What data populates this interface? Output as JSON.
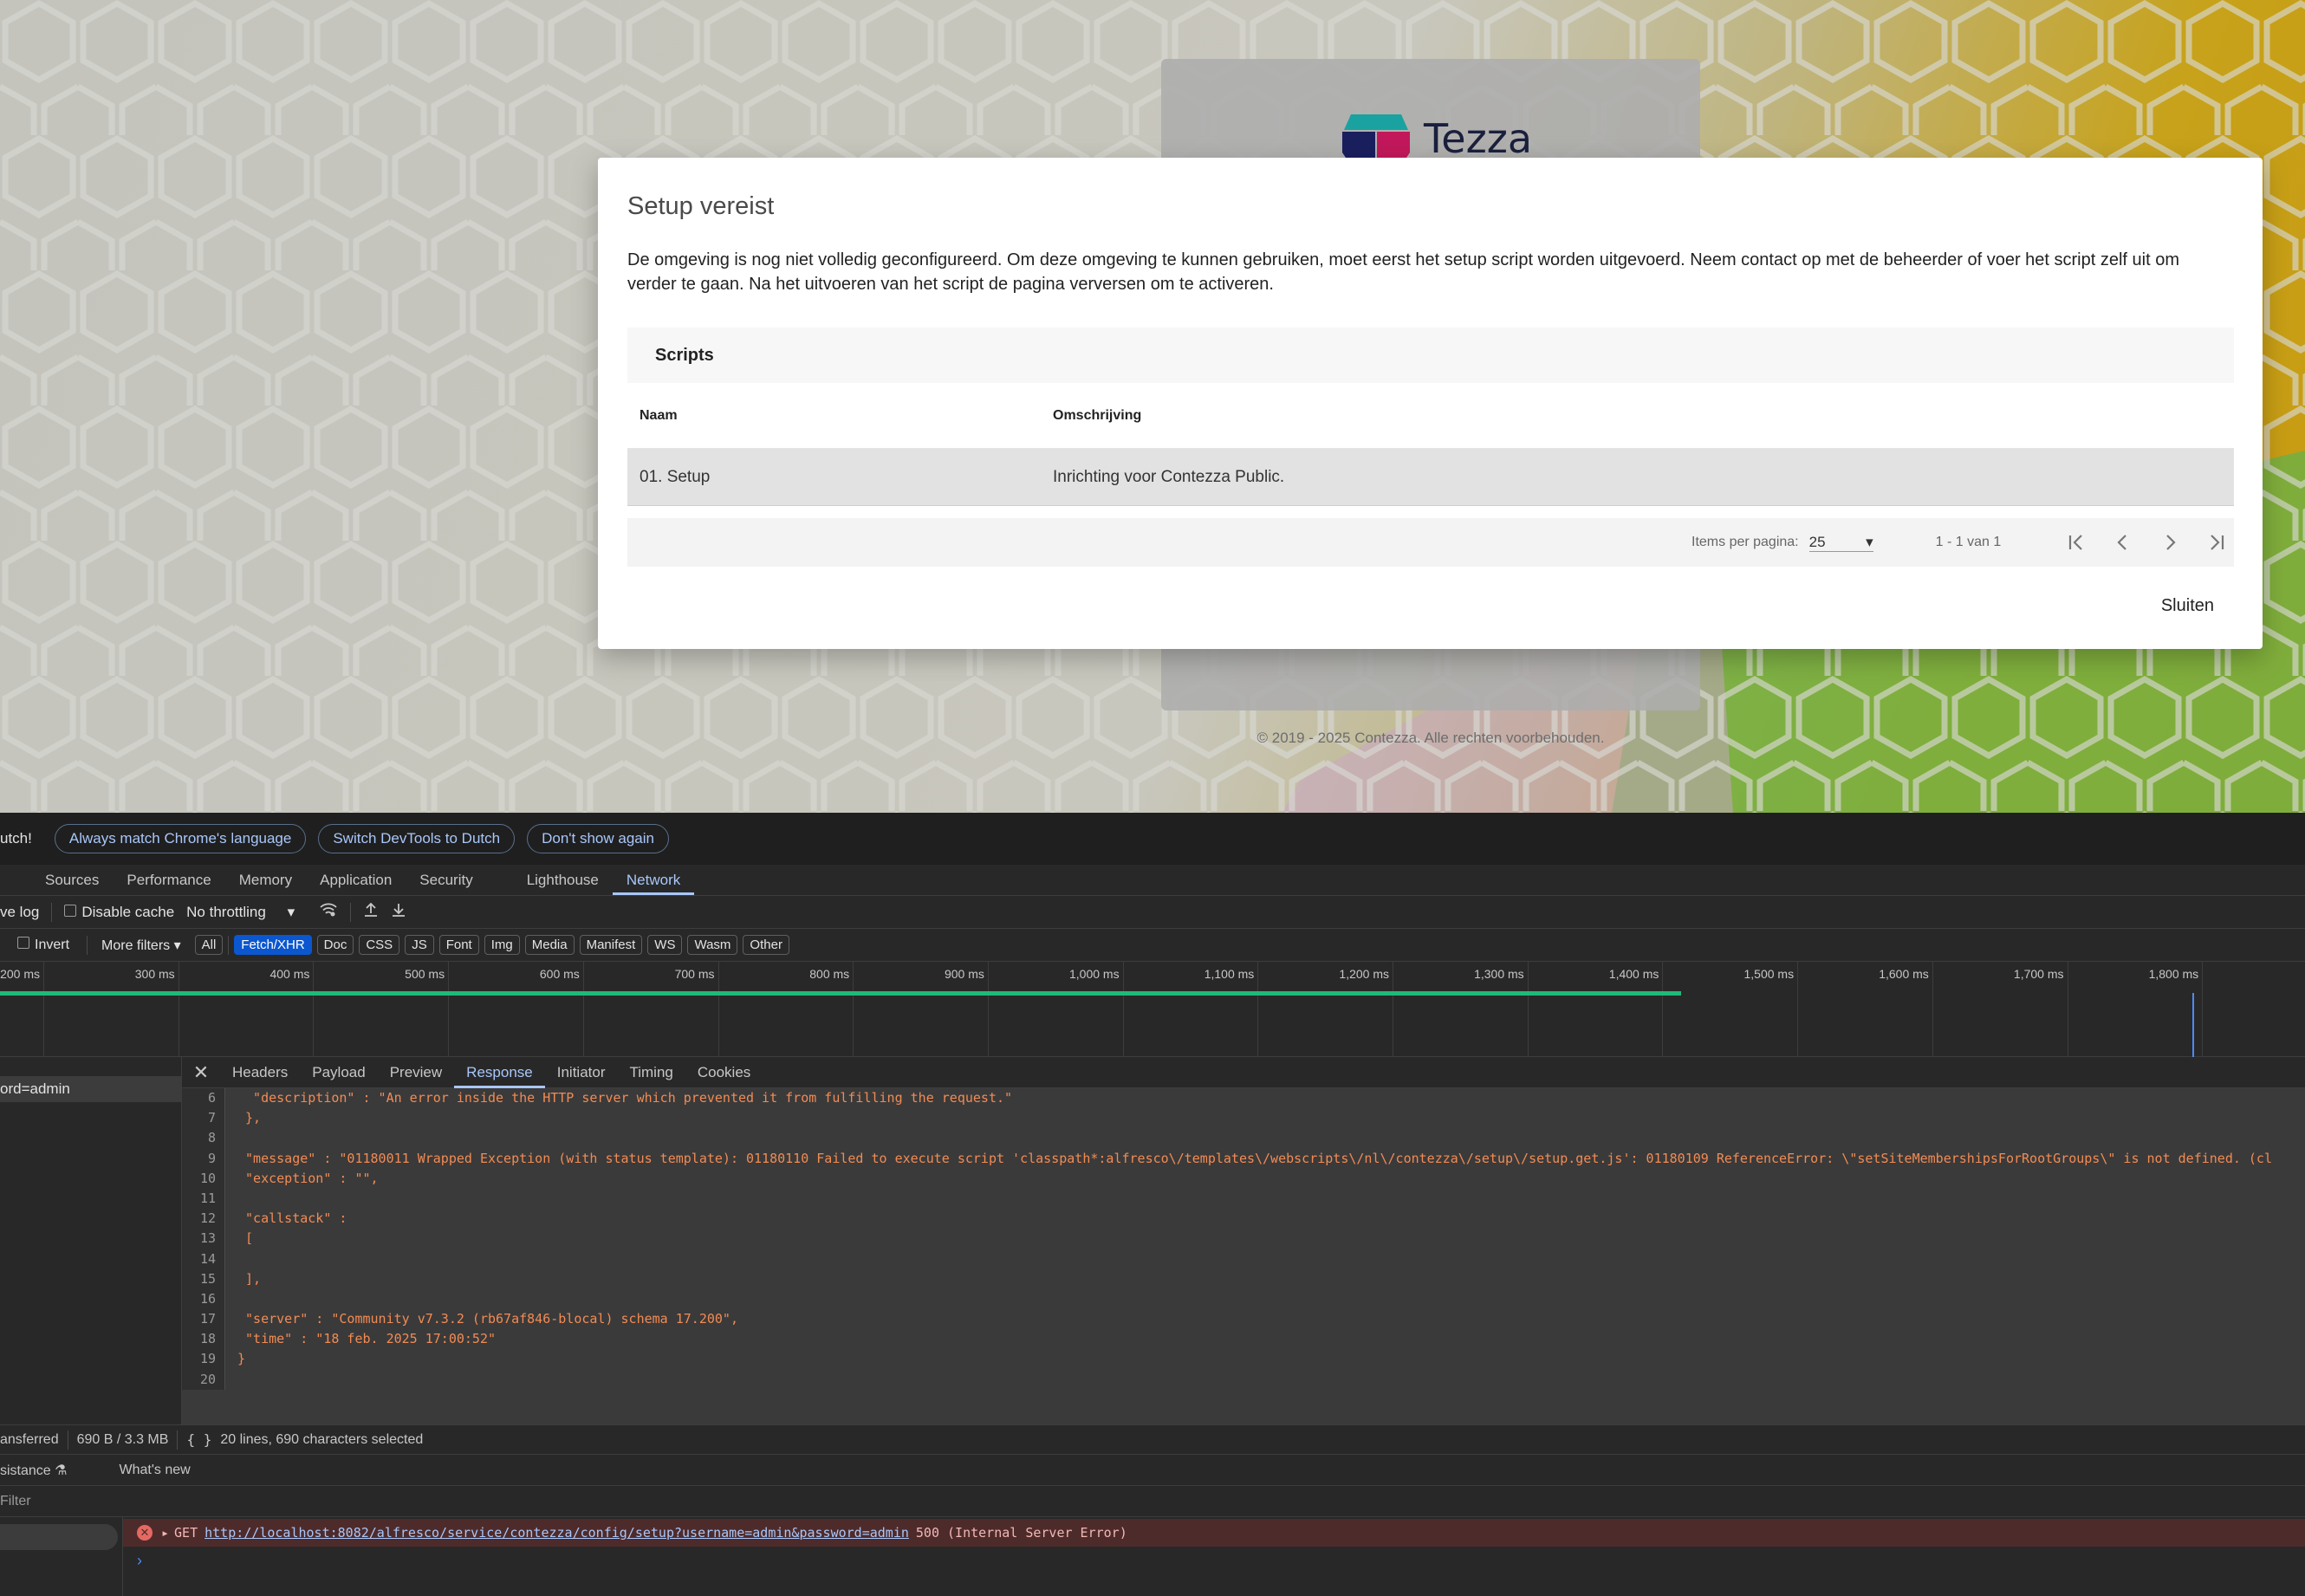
{
  "app": {
    "logo_text": "Tezza",
    "copyright": "© 2019 - 2025 Contezza. Alle rechten voorbehouden."
  },
  "modal": {
    "title": "Setup vereist",
    "description": "De omgeving is nog niet volledig geconfigureerd. Om deze omgeving te kunnen gebruiken, moet eerst het setup script worden uitgevoerd. Neem contact op met de beheerder of voer het script zelf uit om verder te gaan. Na het uitvoeren van het script de pagina verversen om te activeren.",
    "scripts_heading": "Scripts",
    "columns": {
      "naam": "Naam",
      "omschrijving": "Omschrijving"
    },
    "rows": [
      {
        "naam": "01. Setup",
        "omschrijving": "Inrichting voor Contezza Public."
      }
    ],
    "paginator": {
      "label": "Items per pagina:",
      "page_size": "25",
      "range": "1 - 1 van 1"
    },
    "close_label": "Sluiten"
  },
  "devtools": {
    "infobar": {
      "text": "utch!",
      "buttons": [
        "Always match Chrome's language",
        "Switch DevTools to Dutch",
        "Don't show again"
      ]
    },
    "panel_tabs": [
      "Sources",
      "Performance",
      "Memory",
      "Application",
      "Security",
      "Lighthouse",
      "Network"
    ],
    "active_panel": "Network",
    "toolbar": {
      "preserve_log": "ve log",
      "disable_cache": "Disable cache",
      "throttling": "No throttling"
    },
    "filters": {
      "invert": "Invert",
      "more_filters": "More filters",
      "chips": [
        "All",
        "Fetch/XHR",
        "Doc",
        "CSS",
        "JS",
        "Font",
        "Img",
        "Media",
        "Manifest",
        "WS",
        "Wasm",
        "Other"
      ],
      "active_chip": "Fetch/XHR"
    },
    "timeline_ticks": [
      "200 ms",
      "300 ms",
      "400 ms",
      "500 ms",
      "600 ms",
      "700 ms",
      "800 ms",
      "900 ms",
      "1,000 ms",
      "1,100 ms",
      "1,200 ms",
      "1,300 ms",
      "1,400 ms",
      "1,500 ms",
      "1,600 ms",
      "1,700 ms",
      "1,800 ms",
      "1,90"
    ],
    "request_name": "ord=admin",
    "detail_tabs": [
      "Headers",
      "Payload",
      "Preview",
      "Response",
      "Initiator",
      "Timing",
      "Cookies"
    ],
    "active_detail_tab": "Response",
    "response_lines": [
      {
        "n": "6",
        "t": "  \"description\" : \"An error inside the HTTP server which prevented it from fulfilling the request.\""
      },
      {
        "n": "7",
        "t": " },"
      },
      {
        "n": "8",
        "t": ""
      },
      {
        "n": "9",
        "t": " \"message\" : \"01180011 Wrapped Exception (with status template): 01180110 Failed to execute script 'classpath*:alfresco\\/templates\\/webscripts\\/nl\\/contezza\\/setup\\/setup.get.js': 01180109 ReferenceError: \\\"setSiteMembershipsForRootGroups\\\" is not defined. (cl"
      },
      {
        "n": "10",
        "t": " \"exception\" : \"\","
      },
      {
        "n": "11",
        "t": ""
      },
      {
        "n": "12",
        "t": " \"callstack\" :"
      },
      {
        "n": "13",
        "t": " ["
      },
      {
        "n": "14",
        "t": ""
      },
      {
        "n": "15",
        "t": " ],"
      },
      {
        "n": "16",
        "t": ""
      },
      {
        "n": "17",
        "t": " \"server\" : \"Community v7.3.2 (rb67af846-blocal) schema 17.200\","
      },
      {
        "n": "18",
        "t": " \"time\" : \"18 feb. 2025 17:00:52\""
      },
      {
        "n": "19",
        "t": "}"
      },
      {
        "n": "20",
        "t": ""
      }
    ],
    "status": {
      "transferred": "ansferred",
      "size": "690 B / 3.3 MB",
      "selection": "20 lines, 690 characters selected"
    },
    "drawer": {
      "assistance": "sistance",
      "whats_new": "What's new"
    },
    "console_filter": "Filter",
    "console_error": {
      "method": "GET",
      "url": "http://localhost:8082/alfresco/service/contezza/config/setup?username=admin&password=admin",
      "status": "500 (Internal Server Error)"
    },
    "colors": {
      "accent": "#a8c7fa",
      "active_chip": "#0b57d0",
      "timeline_bar": "#1fb87a",
      "error_bg": "#4e2b2b"
    }
  }
}
